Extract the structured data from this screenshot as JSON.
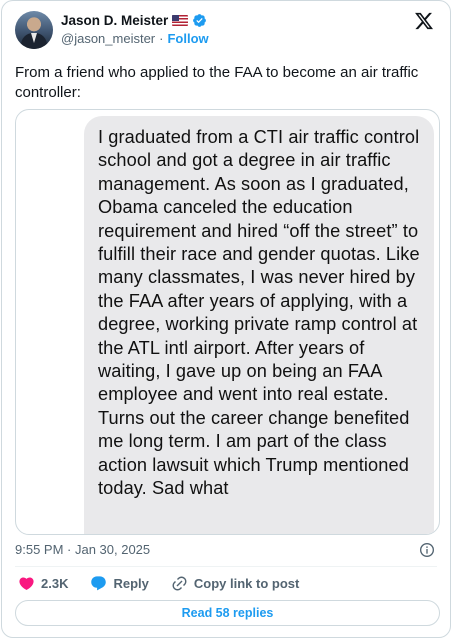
{
  "author": {
    "name": "Jason D. Meister",
    "handle": "@jason_meister",
    "separator": "·",
    "follow_label": "Follow"
  },
  "tweet": {
    "text": "From a friend who applied to the FAA to become an air traffic controller:",
    "image_text": "I graduated from a CTI air traffic control school and got a degree in air traffic management. As soon as I graduated, Obama canceled the education requirement and hired “off the street” to fulfill their race and gender quotas. Like many classmates, I was never hired by the FAA after years of applying, with a degree, working private ramp control at the ATL intl airport. After years of waiting, I gave up on being an FAA employee and went into real estate. Turns out the career change benefited me long term. I am part of the class action lawsuit which Trump mentioned today. Sad what",
    "timestamp": "9:55 PM · Jan 30, 2025"
  },
  "actions": {
    "likes": "2.3K",
    "reply_label": "Reply",
    "copy_link_label": "Copy link to post"
  },
  "read_replies_label": "Read 58 replies",
  "colors": {
    "accent": "#1d9bf0",
    "like": "#f91880",
    "muted": "#536471",
    "bubble": "#e9e9eb"
  },
  "icons": [
    "verified-badge-icon",
    "us-flag-icon",
    "x-logo-icon",
    "info-icon",
    "heart-icon",
    "reply-icon",
    "link-icon"
  ]
}
